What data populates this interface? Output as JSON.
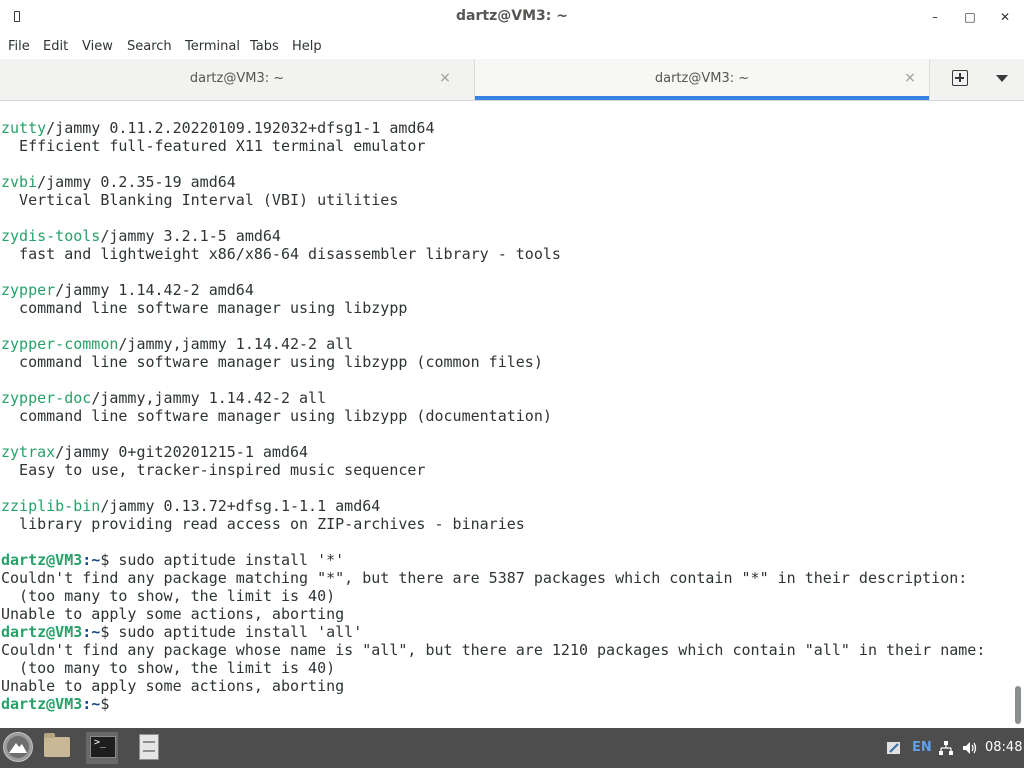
{
  "window": {
    "title": "dartz@VM3: ~",
    "minimize_glyph": "–",
    "maximize_glyph": "□",
    "close_glyph": "✕"
  },
  "menu": {
    "items": [
      "File",
      "Edit",
      "View",
      "Search",
      "Terminal",
      "Tabs",
      "Help"
    ]
  },
  "tabs": [
    {
      "label": "dartz@VM3: ~",
      "active": false,
      "close": "×"
    },
    {
      "label": "dartz@VM3: ~",
      "active": true,
      "close": "×"
    }
  ],
  "terminal": {
    "lines": [
      {
        "pkg": "zutty",
        "rest": "/jammy 0.11.2.20220109.192032+dfsg1-1 amd64"
      },
      {
        "text": "  Efficient full-featured X11 terminal emulator"
      },
      {
        "text": ""
      },
      {
        "pkg": "zvbi",
        "rest": "/jammy 0.2.35-19 amd64"
      },
      {
        "text": "  Vertical Blanking Interval (VBI) utilities"
      },
      {
        "text": ""
      },
      {
        "pkg": "zydis-tools",
        "rest": "/jammy 3.2.1-5 amd64"
      },
      {
        "text": "  fast and lightweight x86/x86-64 disassembler library - tools"
      },
      {
        "text": ""
      },
      {
        "pkg": "zypper",
        "rest": "/jammy 1.14.42-2 amd64"
      },
      {
        "text": "  command line software manager using libzypp"
      },
      {
        "text": ""
      },
      {
        "pkg": "zypper-common",
        "rest": "/jammy,jammy 1.14.42-2 all"
      },
      {
        "text": "  command line software manager using libzypp (common files)"
      },
      {
        "text": ""
      },
      {
        "pkg": "zypper-doc",
        "rest": "/jammy,jammy 1.14.42-2 all"
      },
      {
        "text": "  command line software manager using libzypp (documentation)"
      },
      {
        "text": ""
      },
      {
        "pkg": "zytrax",
        "rest": "/jammy 0+git20201215-1 amd64"
      },
      {
        "text": "  Easy to use, tracker-inspired music sequencer"
      },
      {
        "text": ""
      },
      {
        "pkg": "zziplib-bin",
        "rest": "/jammy 0.13.72+dfsg.1-1.1 amd64"
      },
      {
        "text": "  library providing read access on ZIP-archives - binaries"
      },
      {
        "text": ""
      },
      {
        "user": "dartz@VM3",
        "path": ":~",
        "cmd": "$ sudo aptitude install '*'"
      },
      {
        "text": "Couldn't find any package matching \"*\", but there are 5387 packages which contain \"*\" in their description:"
      },
      {
        "text": "  (too many to show, the limit is 40)"
      },
      {
        "text": "Unable to apply some actions, aborting"
      },
      {
        "user": "dartz@VM3",
        "path": ":~",
        "cmd": "$ sudo aptitude install 'all'"
      },
      {
        "text": "Couldn't find any package whose name is \"all\", but there are 1210 packages which contain \"all\" in their name:"
      },
      {
        "text": "  (too many to show, the limit is 40)"
      },
      {
        "text": "Unable to apply some actions, aborting"
      },
      {
        "user": "dartz@VM3",
        "path": ":~",
        "cmd": "$ "
      }
    ]
  },
  "taskbar": {
    "apps": [
      "menu-icon",
      "file-manager-icon",
      "terminal-icon",
      "file-cabinet-icon"
    ],
    "terminal_glyph": ">_",
    "lang": "EN",
    "clock": "08:48"
  },
  "colors": {
    "accent": "#3584e4",
    "package_name": "#26a269",
    "prompt_path": "#12488b",
    "taskbar": "#4d4d4d"
  }
}
